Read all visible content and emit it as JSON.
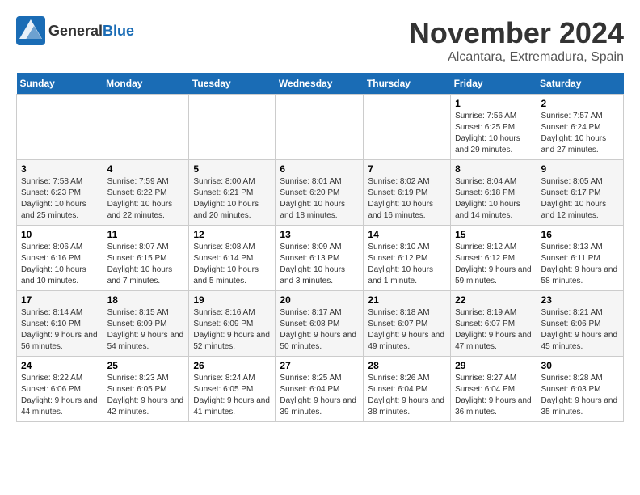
{
  "header": {
    "logo_general": "General",
    "logo_blue": "Blue",
    "month": "November 2024",
    "location": "Alcantara, Extremadura, Spain"
  },
  "weekdays": [
    "Sunday",
    "Monday",
    "Tuesday",
    "Wednesday",
    "Thursday",
    "Friday",
    "Saturday"
  ],
  "weeks": [
    [
      {
        "day": "",
        "info": ""
      },
      {
        "day": "",
        "info": ""
      },
      {
        "day": "",
        "info": ""
      },
      {
        "day": "",
        "info": ""
      },
      {
        "day": "",
        "info": ""
      },
      {
        "day": "1",
        "info": "Sunrise: 7:56 AM\nSunset: 6:25 PM\nDaylight: 10 hours and 29 minutes."
      },
      {
        "day": "2",
        "info": "Sunrise: 7:57 AM\nSunset: 6:24 PM\nDaylight: 10 hours and 27 minutes."
      }
    ],
    [
      {
        "day": "3",
        "info": "Sunrise: 7:58 AM\nSunset: 6:23 PM\nDaylight: 10 hours and 25 minutes."
      },
      {
        "day": "4",
        "info": "Sunrise: 7:59 AM\nSunset: 6:22 PM\nDaylight: 10 hours and 22 minutes."
      },
      {
        "day": "5",
        "info": "Sunrise: 8:00 AM\nSunset: 6:21 PM\nDaylight: 10 hours and 20 minutes."
      },
      {
        "day": "6",
        "info": "Sunrise: 8:01 AM\nSunset: 6:20 PM\nDaylight: 10 hours and 18 minutes."
      },
      {
        "day": "7",
        "info": "Sunrise: 8:02 AM\nSunset: 6:19 PM\nDaylight: 10 hours and 16 minutes."
      },
      {
        "day": "8",
        "info": "Sunrise: 8:04 AM\nSunset: 6:18 PM\nDaylight: 10 hours and 14 minutes."
      },
      {
        "day": "9",
        "info": "Sunrise: 8:05 AM\nSunset: 6:17 PM\nDaylight: 10 hours and 12 minutes."
      }
    ],
    [
      {
        "day": "10",
        "info": "Sunrise: 8:06 AM\nSunset: 6:16 PM\nDaylight: 10 hours and 10 minutes."
      },
      {
        "day": "11",
        "info": "Sunrise: 8:07 AM\nSunset: 6:15 PM\nDaylight: 10 hours and 7 minutes."
      },
      {
        "day": "12",
        "info": "Sunrise: 8:08 AM\nSunset: 6:14 PM\nDaylight: 10 hours and 5 minutes."
      },
      {
        "day": "13",
        "info": "Sunrise: 8:09 AM\nSunset: 6:13 PM\nDaylight: 10 hours and 3 minutes."
      },
      {
        "day": "14",
        "info": "Sunrise: 8:10 AM\nSunset: 6:12 PM\nDaylight: 10 hours and 1 minute."
      },
      {
        "day": "15",
        "info": "Sunrise: 8:12 AM\nSunset: 6:12 PM\nDaylight: 9 hours and 59 minutes."
      },
      {
        "day": "16",
        "info": "Sunrise: 8:13 AM\nSunset: 6:11 PM\nDaylight: 9 hours and 58 minutes."
      }
    ],
    [
      {
        "day": "17",
        "info": "Sunrise: 8:14 AM\nSunset: 6:10 PM\nDaylight: 9 hours and 56 minutes."
      },
      {
        "day": "18",
        "info": "Sunrise: 8:15 AM\nSunset: 6:09 PM\nDaylight: 9 hours and 54 minutes."
      },
      {
        "day": "19",
        "info": "Sunrise: 8:16 AM\nSunset: 6:09 PM\nDaylight: 9 hours and 52 minutes."
      },
      {
        "day": "20",
        "info": "Sunrise: 8:17 AM\nSunset: 6:08 PM\nDaylight: 9 hours and 50 minutes."
      },
      {
        "day": "21",
        "info": "Sunrise: 8:18 AM\nSunset: 6:07 PM\nDaylight: 9 hours and 49 minutes."
      },
      {
        "day": "22",
        "info": "Sunrise: 8:19 AM\nSunset: 6:07 PM\nDaylight: 9 hours and 47 minutes."
      },
      {
        "day": "23",
        "info": "Sunrise: 8:21 AM\nSunset: 6:06 PM\nDaylight: 9 hours and 45 minutes."
      }
    ],
    [
      {
        "day": "24",
        "info": "Sunrise: 8:22 AM\nSunset: 6:06 PM\nDaylight: 9 hours and 44 minutes."
      },
      {
        "day": "25",
        "info": "Sunrise: 8:23 AM\nSunset: 6:05 PM\nDaylight: 9 hours and 42 minutes."
      },
      {
        "day": "26",
        "info": "Sunrise: 8:24 AM\nSunset: 6:05 PM\nDaylight: 9 hours and 41 minutes."
      },
      {
        "day": "27",
        "info": "Sunrise: 8:25 AM\nSunset: 6:04 PM\nDaylight: 9 hours and 39 minutes."
      },
      {
        "day": "28",
        "info": "Sunrise: 8:26 AM\nSunset: 6:04 PM\nDaylight: 9 hours and 38 minutes."
      },
      {
        "day": "29",
        "info": "Sunrise: 8:27 AM\nSunset: 6:04 PM\nDaylight: 9 hours and 36 minutes."
      },
      {
        "day": "30",
        "info": "Sunrise: 8:28 AM\nSunset: 6:03 PM\nDaylight: 9 hours and 35 minutes."
      }
    ]
  ]
}
